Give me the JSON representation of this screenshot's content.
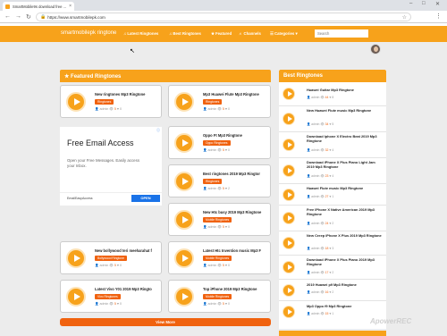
{
  "browser": {
    "tab_title": "SmartMobile9s download free ...",
    "url": "https://www.smartmobilepk.com",
    "ctrl_min": "–",
    "ctrl_max": "□",
    "ctrl_close": "✕"
  },
  "site": {
    "brand": "smartmobilepk ringtone",
    "nav": [
      {
        "label": "♫ Latest Ringtones"
      },
      {
        "label": "♫ Best Ringtones"
      },
      {
        "label": "★ Featured"
      },
      {
        "label": "♬ Channels"
      },
      {
        "label": "☰ Categories ▾"
      }
    ],
    "search_placeholder": "Search"
  },
  "featured": {
    "heading": "★ Featured Ringtones",
    "view_more": "View More",
    "cards": [
      {
        "title": "New ringtones Mp3 Ringtone",
        "tag": "Ringtones",
        "author": "admin",
        "views": "5",
        "likes": "0"
      },
      {
        "title": "Mp3 Huawei Flute Mp3 Ringtone",
        "tag": "Ringtones",
        "author": "admin",
        "views": "5",
        "likes": "0"
      },
      {
        "title": "Oppo Ft Mp3 Ringtone",
        "tag": "Oppo Ringtones",
        "author": "admin",
        "views": "5",
        "likes": "0"
      },
      {
        "title": "Best ringtones 2019 Mp3 Ringtor",
        "tag": "Ringtones",
        "author": "admin",
        "views": "5",
        "likes": "2"
      },
      {
        "title": "New Htc busy 2019 Mp3 Ringtone",
        "tag": "Mobile Ringtones",
        "author": "admin",
        "views": "5",
        "likes": "0"
      },
      {
        "title": "New bollywood teri meeharahat f",
        "tag": "Bollywood Ringtone",
        "author": "admin",
        "views": "5",
        "likes": "0"
      },
      {
        "title": "Latest Htc Invention music Mp3 F",
        "tag": "Mobile Ringtones",
        "author": "admin",
        "views": "5",
        "likes": "0"
      },
      {
        "title": "Latest Vivo Y01 2019 Mp3 Ringto",
        "tag": "Vivo Ringtones",
        "author": "admin",
        "views": "5",
        "likes": "0"
      },
      {
        "title": "Top iPhone 2019 Mp3 Ringtone",
        "tag": "Mobile Ringtones",
        "author": "admin",
        "views": "5",
        "likes": "0"
      }
    ]
  },
  "ad": {
    "headline": "Free Email Access",
    "body": "Open your Free Messages. Easily access your Inbox.",
    "source": "EmailEasyAccess",
    "cta": "OPEN",
    "info_icon": "ⓘ"
  },
  "best": {
    "heading": "Best Ringtones",
    "items": [
      {
        "title": "Huawei Guitar Mp3 Ringtone",
        "author": "admin",
        "views": "44",
        "likes": "8"
      },
      {
        "title": "New Huawei Flute music Mp3 Ringtone",
        "author": "admin",
        "views": "34",
        "likes": "5"
      },
      {
        "title": "Download Iphone X Electro Beat 2019 Mp3 Ringtone",
        "author": "admin",
        "views": "32",
        "likes": "4"
      },
      {
        "title": "Download iPhone X Plus Piano Light Jam 2019 Mp3 Ringtone",
        "author": "admin",
        "views": "23",
        "likes": "4"
      },
      {
        "title": "Huawei Flute music Mp3 Ringtone",
        "author": "admin",
        "views": "27",
        "likes": "1"
      },
      {
        "title": "Free IPhone X Native American 2019 Mp3 Ringtone",
        "author": "admin",
        "views": "24",
        "likes": "2"
      },
      {
        "title": "New Creep iPhone X Plus 2019 Mp3 Ringtone",
        "author": "admin",
        "views": "18",
        "likes": "3"
      },
      {
        "title": "Download iPhone X Plus Piano 2019 Mp3 Ringtone",
        "author": "admin",
        "views": "17",
        "likes": "2"
      },
      {
        "title": "2019 Huawei p9 Mp3 Ringtone",
        "author": "admin",
        "views": "16",
        "likes": "2"
      },
      {
        "title": "Mp3 Oppo f9 Mp3 Ringtone",
        "author": "admin",
        "views": "15",
        "likes": "1"
      }
    ]
  },
  "watermark": "ApowerREC"
}
